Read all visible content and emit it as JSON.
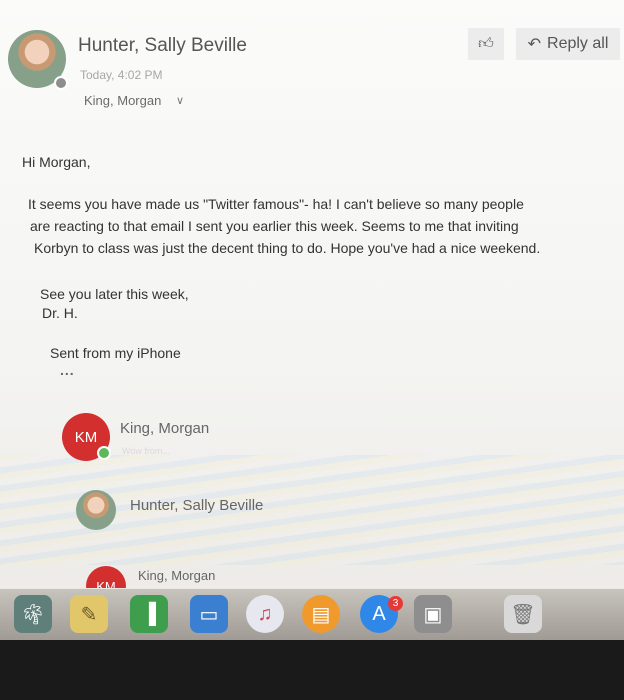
{
  "message": {
    "sender": "Hunter, Sally Beville",
    "date": "Today, 4:02 PM",
    "recipient": "King, Morgan",
    "actions": {
      "reply_all": "Reply all"
    },
    "greeting": "Hi Morgan,",
    "paragraph_lines": [
      "It seems you have made us \"Twitter famous\"- ha! I can't believe so many people",
      "are reacting to that email I sent you earlier this week. Seems to me that inviting",
      "Korbyn to class was just the decent thing to do. Hope you've had a nice weekend."
    ],
    "closing": "See you later this week,",
    "signature": "Dr. H.",
    "footer": "Sent from my iPhone",
    "more": "..."
  },
  "thread": [
    {
      "initials": "KM",
      "name": "King, Morgan"
    },
    {
      "name": "Hunter, Sally Beville"
    },
    {
      "initials": "KM",
      "name": "King, Morgan"
    }
  ],
  "dock": {
    "app_store_badge": "3",
    "icons": [
      "photo-browser-icon",
      "notes-icon",
      "numbers-icon",
      "keynote-icon",
      "music-icon",
      "books-icon",
      "app-store-icon",
      "image-capture-icon",
      "trash-icon"
    ]
  },
  "colors": {
    "accent_red": "#d32f2f",
    "presence_green": "#5bb85d"
  }
}
